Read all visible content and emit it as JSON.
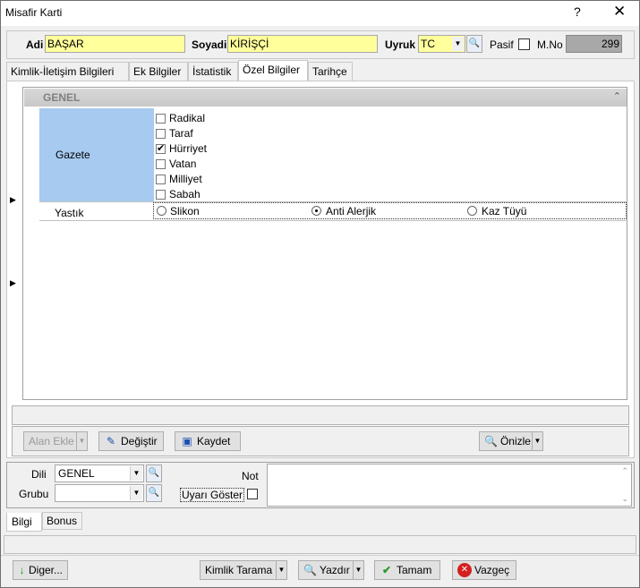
{
  "window": {
    "title": "Misafir Karti",
    "help": "?",
    "close": "✕"
  },
  "header": {
    "adi_label": "Adi",
    "adi_value": "BAŞAR",
    "soyadi_label": "Soyadi",
    "soyadi_value": "KİRİŞÇİ",
    "uyruk_label": "Uyruk",
    "uyruk_value": "TC",
    "pasif_label": "Pasif",
    "mno_label": "M.No",
    "mno_value": "299"
  },
  "tabs": [
    "Kimlik-İletişim Bilgileri",
    "Ek Bilgiler",
    "İstatistik",
    "Özel Bilgiler",
    "Tarihçe"
  ],
  "grid": {
    "group_title": "GENEL",
    "gazete_label": "Gazete",
    "gazete_options": [
      {
        "label": "Radikal",
        "checked": false
      },
      {
        "label": "Taraf",
        "checked": false
      },
      {
        "label": "Hürriyet",
        "checked": true
      },
      {
        "label": "Vatan",
        "checked": false
      },
      {
        "label": "Milliyet",
        "checked": false
      },
      {
        "label": "Sabah",
        "checked": false
      }
    ],
    "yastik_label": "Yastık",
    "yastik_options": [
      {
        "label": "Slikon",
        "selected": false
      },
      {
        "label": "Anti Alerjik",
        "selected": true
      },
      {
        "label": "Kaz Tüyü",
        "selected": false
      }
    ]
  },
  "grid_toolbar": {
    "alan_ekle": "Alan Ekle",
    "degistir": "Değiştir",
    "kaydet": "Kaydet",
    "onizle": "Önizle"
  },
  "bottom": {
    "dili_label": "Dili",
    "dili_value": "GENEL",
    "grubu_label": "Grubu",
    "grubu_value": "",
    "not_label": "Not",
    "uyari_label": "Uyarı Göster"
  },
  "bottom_tabs": [
    "Bilgi",
    "Bonus"
  ],
  "footer": {
    "diger": "Diger...",
    "kimlik_tarama": "Kimlik Tarama",
    "yazdir": "Yazdır",
    "tamam": "Tamam",
    "vazgec": "Vazgeç"
  }
}
